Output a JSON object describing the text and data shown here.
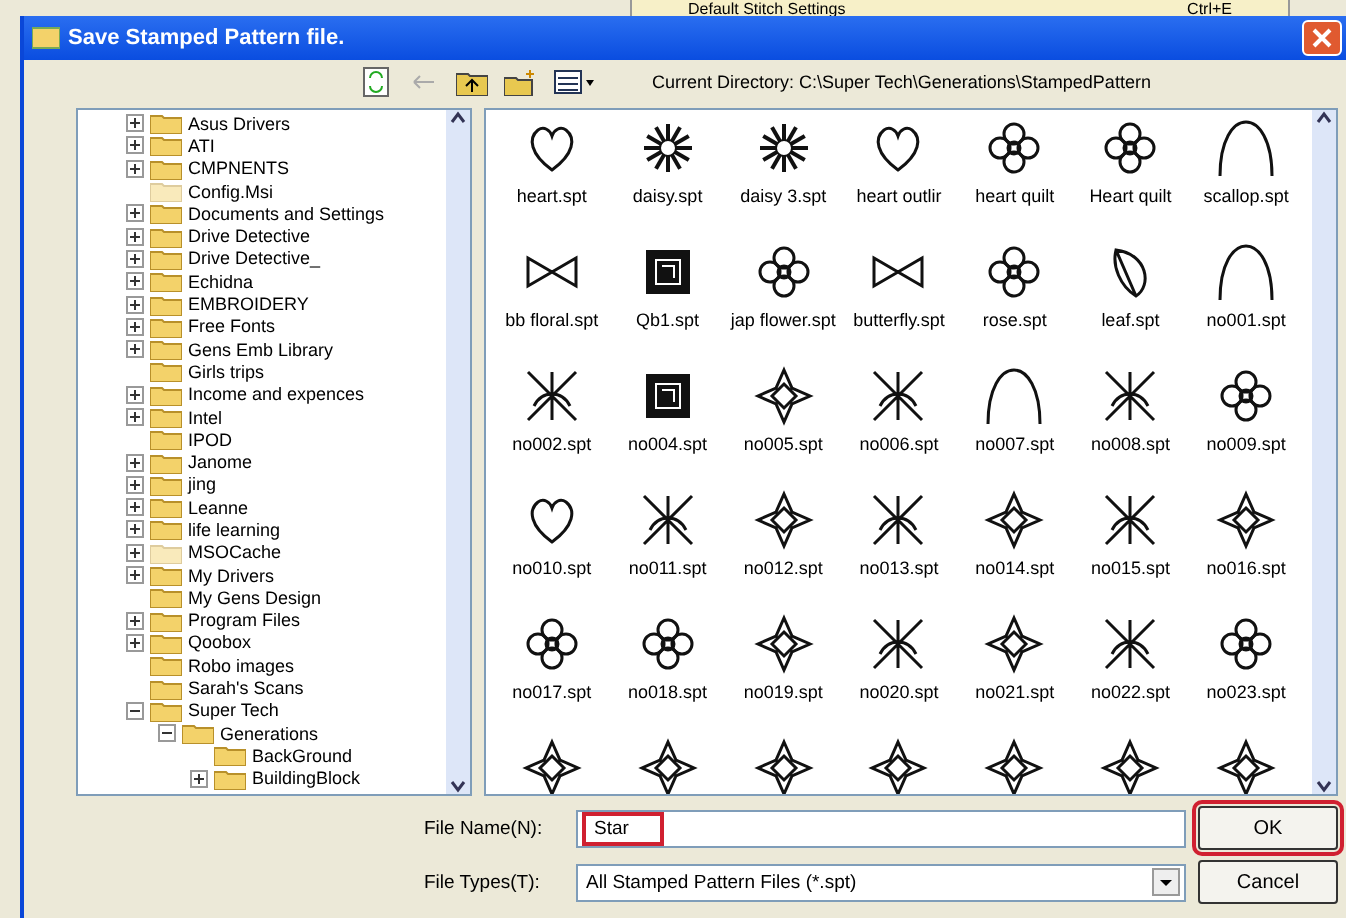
{
  "background_menu": {
    "label": "Default Stitch Settings",
    "shortcut": "Ctrl+E"
  },
  "window": {
    "title": "Save Stamped Pattern file."
  },
  "toolbar": {
    "current_directory": "Current Directory: C:\\Super Tech\\Generations\\StampedPattern"
  },
  "tree": [
    {
      "label": "Asus Drivers",
      "expandable": true,
      "hidden": false
    },
    {
      "label": "ATI",
      "expandable": true,
      "hidden": false
    },
    {
      "label": "CMPNENTS",
      "expandable": true,
      "hidden": false
    },
    {
      "label": "Config.Msi",
      "expandable": false,
      "hidden": true
    },
    {
      "label": "Documents and Settings",
      "expandable": true,
      "hidden": false
    },
    {
      "label": "Drive Detective",
      "expandable": true,
      "hidden": false
    },
    {
      "label": "Drive Detective_",
      "expandable": true,
      "hidden": false
    },
    {
      "label": "Echidna",
      "expandable": true,
      "hidden": false
    },
    {
      "label": "EMBROIDERY",
      "expandable": true,
      "hidden": false
    },
    {
      "label": "Free Fonts",
      "expandable": true,
      "hidden": false
    },
    {
      "label": "Gens Emb Library",
      "expandable": true,
      "hidden": false
    },
    {
      "label": "Girls trips",
      "expandable": false,
      "hidden": false
    },
    {
      "label": "Income and expences",
      "expandable": true,
      "hidden": false
    },
    {
      "label": "Intel",
      "expandable": true,
      "hidden": false
    },
    {
      "label": "IPOD",
      "expandable": false,
      "hidden": false
    },
    {
      "label": "Janome",
      "expandable": true,
      "hidden": false
    },
    {
      "label": "jing",
      "expandable": true,
      "hidden": false
    },
    {
      "label": "Leanne",
      "expandable": true,
      "hidden": false
    },
    {
      "label": "life learning",
      "expandable": true,
      "hidden": false
    },
    {
      "label": "MSOCache",
      "expandable": true,
      "hidden": true
    },
    {
      "label": "My Drivers",
      "expandable": true,
      "hidden": false
    },
    {
      "label": "My Gens Design",
      "expandable": false,
      "hidden": false
    },
    {
      "label": "Program Files",
      "expandable": true,
      "hidden": false
    },
    {
      "label": "Qoobox",
      "expandable": true,
      "hidden": false
    },
    {
      "label": "Robo images",
      "expandable": false,
      "hidden": false
    },
    {
      "label": "Sarah's Scans",
      "expandable": false,
      "hidden": false
    },
    {
      "label": "Super Tech",
      "expandable": true,
      "expanded": true,
      "hidden": false,
      "children": [
        {
          "label": "Generations",
          "expandable": true,
          "expanded": true,
          "hidden": false,
          "children": [
            {
              "label": "BackGround",
              "expandable": false,
              "hidden": false
            },
            {
              "label": "BuildingBlock",
              "expandable": true,
              "hidden": false
            }
          ]
        }
      ]
    }
  ],
  "files": [
    {
      "label": "heart.spt",
      "kind": "heart"
    },
    {
      "label": "daisy.spt",
      "kind": "daisy"
    },
    {
      "label": "daisy 3.spt",
      "kind": "daisy"
    },
    {
      "label": "heart outlir",
      "kind": "heart"
    },
    {
      "label": "heart quilt",
      "kind": "flower"
    },
    {
      "label": "Heart quilt",
      "kind": "flower"
    },
    {
      "label": "scallop.spt",
      "kind": "arc"
    },
    {
      "label": "bb floral.spt",
      "kind": "bow"
    },
    {
      "label": "Qb1.spt",
      "kind": "block"
    },
    {
      "label": "jap flower.spt",
      "kind": "flower"
    },
    {
      "label": "butterfly.spt",
      "kind": "bow"
    },
    {
      "label": "rose.spt",
      "kind": "flower"
    },
    {
      "label": "leaf.spt",
      "kind": "leaf"
    },
    {
      "label": "no001.spt",
      "kind": "arc"
    },
    {
      "label": "no002.spt",
      "kind": "pattern"
    },
    {
      "label": "no004.spt",
      "kind": "block"
    },
    {
      "label": "no005.spt",
      "kind": "star"
    },
    {
      "label": "no006.spt",
      "kind": "pattern"
    },
    {
      "label": "no007.spt",
      "kind": "arc"
    },
    {
      "label": "no008.spt",
      "kind": "pattern"
    },
    {
      "label": "no009.spt",
      "kind": "flower"
    },
    {
      "label": "no010.spt",
      "kind": "heart"
    },
    {
      "label": "no011.spt",
      "kind": "pattern"
    },
    {
      "label": "no012.spt",
      "kind": "star"
    },
    {
      "label": "no013.spt",
      "kind": "pattern"
    },
    {
      "label": "no014.spt",
      "kind": "star"
    },
    {
      "label": "no015.spt",
      "kind": "pattern"
    },
    {
      "label": "no016.spt",
      "kind": "star"
    },
    {
      "label": "no017.spt",
      "kind": "flower"
    },
    {
      "label": "no018.spt",
      "kind": "flower"
    },
    {
      "label": "no019.spt",
      "kind": "star"
    },
    {
      "label": "no020.spt",
      "kind": "pattern"
    },
    {
      "label": "no021.spt",
      "kind": "star"
    },
    {
      "label": "no022.spt",
      "kind": "pattern"
    },
    {
      "label": "no023.spt",
      "kind": "flower"
    }
  ],
  "file_name": {
    "label": "File Name(N):",
    "value": "Star"
  },
  "file_type": {
    "label": "File Types(T):",
    "value": "All Stamped Pattern Files (*.spt)"
  },
  "buttons": [
    {
      "label": "OK",
      "highlighted": true
    },
    {
      "label": "Cancel",
      "highlighted": false
    }
  ]
}
